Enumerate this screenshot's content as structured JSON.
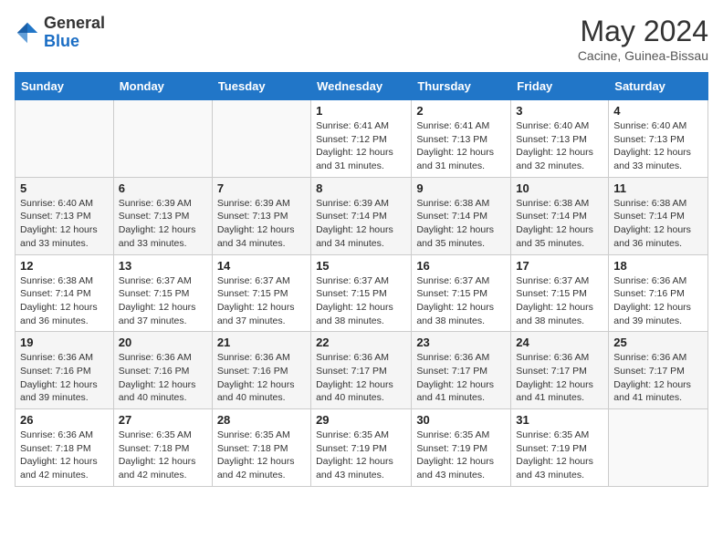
{
  "header": {
    "logo_general": "General",
    "logo_blue": "Blue",
    "title": "May 2024",
    "subtitle": "Cacine, Guinea-Bissau"
  },
  "columns": [
    "Sunday",
    "Monday",
    "Tuesday",
    "Wednesday",
    "Thursday",
    "Friday",
    "Saturday"
  ],
  "weeks": [
    [
      {
        "day": "",
        "info": ""
      },
      {
        "day": "",
        "info": ""
      },
      {
        "day": "",
        "info": ""
      },
      {
        "day": "1",
        "info": "Sunrise: 6:41 AM\nSunset: 7:12 PM\nDaylight: 12 hours and 31 minutes."
      },
      {
        "day": "2",
        "info": "Sunrise: 6:41 AM\nSunset: 7:13 PM\nDaylight: 12 hours and 31 minutes."
      },
      {
        "day": "3",
        "info": "Sunrise: 6:40 AM\nSunset: 7:13 PM\nDaylight: 12 hours and 32 minutes."
      },
      {
        "day": "4",
        "info": "Sunrise: 6:40 AM\nSunset: 7:13 PM\nDaylight: 12 hours and 33 minutes."
      }
    ],
    [
      {
        "day": "5",
        "info": "Sunrise: 6:40 AM\nSunset: 7:13 PM\nDaylight: 12 hours and 33 minutes."
      },
      {
        "day": "6",
        "info": "Sunrise: 6:39 AM\nSunset: 7:13 PM\nDaylight: 12 hours and 33 minutes."
      },
      {
        "day": "7",
        "info": "Sunrise: 6:39 AM\nSunset: 7:13 PM\nDaylight: 12 hours and 34 minutes."
      },
      {
        "day": "8",
        "info": "Sunrise: 6:39 AM\nSunset: 7:14 PM\nDaylight: 12 hours and 34 minutes."
      },
      {
        "day": "9",
        "info": "Sunrise: 6:38 AM\nSunset: 7:14 PM\nDaylight: 12 hours and 35 minutes."
      },
      {
        "day": "10",
        "info": "Sunrise: 6:38 AM\nSunset: 7:14 PM\nDaylight: 12 hours and 35 minutes."
      },
      {
        "day": "11",
        "info": "Sunrise: 6:38 AM\nSunset: 7:14 PM\nDaylight: 12 hours and 36 minutes."
      }
    ],
    [
      {
        "day": "12",
        "info": "Sunrise: 6:38 AM\nSunset: 7:14 PM\nDaylight: 12 hours and 36 minutes."
      },
      {
        "day": "13",
        "info": "Sunrise: 6:37 AM\nSunset: 7:15 PM\nDaylight: 12 hours and 37 minutes."
      },
      {
        "day": "14",
        "info": "Sunrise: 6:37 AM\nSunset: 7:15 PM\nDaylight: 12 hours and 37 minutes."
      },
      {
        "day": "15",
        "info": "Sunrise: 6:37 AM\nSunset: 7:15 PM\nDaylight: 12 hours and 38 minutes."
      },
      {
        "day": "16",
        "info": "Sunrise: 6:37 AM\nSunset: 7:15 PM\nDaylight: 12 hours and 38 minutes."
      },
      {
        "day": "17",
        "info": "Sunrise: 6:37 AM\nSunset: 7:15 PM\nDaylight: 12 hours and 38 minutes."
      },
      {
        "day": "18",
        "info": "Sunrise: 6:36 AM\nSunset: 7:16 PM\nDaylight: 12 hours and 39 minutes."
      }
    ],
    [
      {
        "day": "19",
        "info": "Sunrise: 6:36 AM\nSunset: 7:16 PM\nDaylight: 12 hours and 39 minutes."
      },
      {
        "day": "20",
        "info": "Sunrise: 6:36 AM\nSunset: 7:16 PM\nDaylight: 12 hours and 40 minutes."
      },
      {
        "day": "21",
        "info": "Sunrise: 6:36 AM\nSunset: 7:16 PM\nDaylight: 12 hours and 40 minutes."
      },
      {
        "day": "22",
        "info": "Sunrise: 6:36 AM\nSunset: 7:17 PM\nDaylight: 12 hours and 40 minutes."
      },
      {
        "day": "23",
        "info": "Sunrise: 6:36 AM\nSunset: 7:17 PM\nDaylight: 12 hours and 41 minutes."
      },
      {
        "day": "24",
        "info": "Sunrise: 6:36 AM\nSunset: 7:17 PM\nDaylight: 12 hours and 41 minutes."
      },
      {
        "day": "25",
        "info": "Sunrise: 6:36 AM\nSunset: 7:17 PM\nDaylight: 12 hours and 41 minutes."
      }
    ],
    [
      {
        "day": "26",
        "info": "Sunrise: 6:36 AM\nSunset: 7:18 PM\nDaylight: 12 hours and 42 minutes."
      },
      {
        "day": "27",
        "info": "Sunrise: 6:35 AM\nSunset: 7:18 PM\nDaylight: 12 hours and 42 minutes."
      },
      {
        "day": "28",
        "info": "Sunrise: 6:35 AM\nSunset: 7:18 PM\nDaylight: 12 hours and 42 minutes."
      },
      {
        "day": "29",
        "info": "Sunrise: 6:35 AM\nSunset: 7:19 PM\nDaylight: 12 hours and 43 minutes."
      },
      {
        "day": "30",
        "info": "Sunrise: 6:35 AM\nSunset: 7:19 PM\nDaylight: 12 hours and 43 minutes."
      },
      {
        "day": "31",
        "info": "Sunrise: 6:35 AM\nSunset: 7:19 PM\nDaylight: 12 hours and 43 minutes."
      },
      {
        "day": "",
        "info": ""
      }
    ]
  ]
}
